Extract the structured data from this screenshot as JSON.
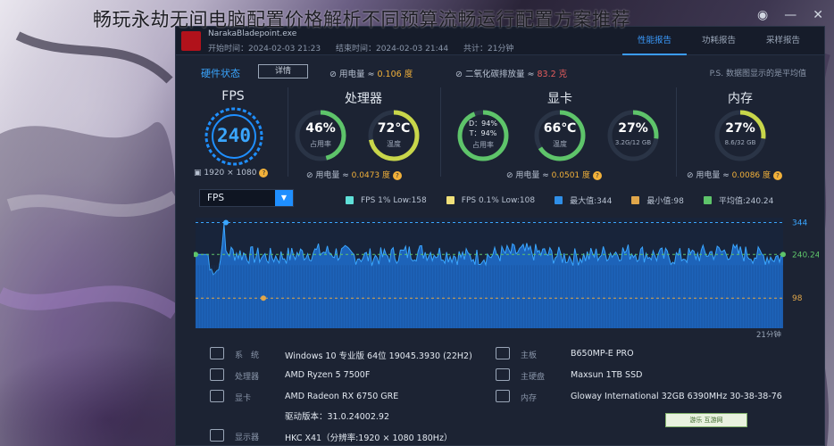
{
  "headline": "畅玩永劫无间电脑配置价格解析不同预算流畅运行配置方案推荐",
  "app": {
    "exe_name": "NarakaBladepoint.exe",
    "start_time": "开始时间：2024-02-03 21:23",
    "end_time": "结束时间：2024-02-03 21:44",
    "duration": "共计：21分钟",
    "tabs": [
      {
        "label": "性能报告",
        "active": true
      },
      {
        "label": "功耗报告",
        "active": false
      },
      {
        "label": "采样报告",
        "active": false
      }
    ],
    "top_icons": [
      "camera-icon",
      "minimize-icon",
      "close-icon"
    ]
  },
  "status": {
    "title": "硬件状态",
    "detail_button": "详情",
    "power_label": "用电量 ≈ ",
    "power_value": "0.106 度",
    "co2_label": "二氧化碳排放量 ≈ ",
    "co2_value": "83.2 克",
    "note": "P.S. 数据图显示的是平均值"
  },
  "fps_panel": {
    "title": "FPS",
    "value": "240",
    "resolution": "1920 × 1080"
  },
  "cpu_panel": {
    "title": "处理器",
    "usage_value": "46%",
    "usage_label": "占用率",
    "usage_fraction": 0.46,
    "temp_value": "72℃",
    "temp_label": "温度",
    "temp_fraction": 0.72,
    "power_label": "用电量 ≈ ",
    "power_value": "0.0473 度"
  },
  "gpu_panel": {
    "title": "显卡",
    "d_line": "D：94%",
    "t_line": "T：94%",
    "usage_label": "占用率",
    "temp_value": "66℃",
    "temp_label": "温度",
    "temp_fraction": 0.66,
    "mem_value": "27%",
    "mem_label": "3.2G/12 GB",
    "mem_fraction": 0.27,
    "power_label": "用电量 ≈ ",
    "power_value": "0.0501 度"
  },
  "mem_panel": {
    "title": "内存",
    "value": "27%",
    "label": "8.6/32 GB",
    "fraction": 0.27,
    "power_label": "用电量 ≈ ",
    "power_value": "0.0086 度"
  },
  "chart_controls": {
    "selected": "FPS"
  },
  "legend": [
    {
      "label": "FPS 1% Low:158",
      "color": "#5fe0d8"
    },
    {
      "label": "FPS 0.1% Low:108",
      "color": "#f0e07a"
    },
    {
      "label": "最大值:344",
      "color": "#2f8fe8"
    },
    {
      "label": "最小值:98",
      "color": "#e0a64a"
    },
    {
      "label": "平均值:240.24",
      "color": "#5ec46a"
    }
  ],
  "chart_data": {
    "type": "area",
    "max": 344,
    "min": 98,
    "avg": 240.24,
    "ymax_label": "344",
    "yavg_label": "240.24",
    "ymin_label": "98",
    "x_end_label": "21分钟",
    "ylim": [
      0,
      360
    ]
  },
  "specs": [
    {
      "key": "系　统",
      "value": "Windows 10 专业版 64位 19045.3930 (22H2)",
      "icon": "system-icon"
    },
    {
      "key": "主板",
      "value": "B650MP-E PRO",
      "icon": "motherboard-icon"
    },
    {
      "key": "处理器",
      "value": "AMD Ryzen 5 7500F",
      "icon": "cpu-icon"
    },
    {
      "key": "主硬盘",
      "value": "Maxsun 1TB SSD",
      "icon": "disk-icon"
    },
    {
      "key": "显卡",
      "value": "AMD Radeon RX 6750 GRE",
      "icon": "gpu-icon"
    },
    {
      "key": "内存",
      "value": "Gloway International 32GB 6390MHz 30-38-38-76",
      "icon": "memory-icon"
    },
    {
      "key": "",
      "value": "驱动版本：31.0.24002.92",
      "icon": ""
    },
    {
      "key": "显示器",
      "value": "HKC X41（分辨率:1920 × 1080 180Hz）",
      "icon": "monitor-icon"
    }
  ],
  "watermark": "游乐 互游网"
}
